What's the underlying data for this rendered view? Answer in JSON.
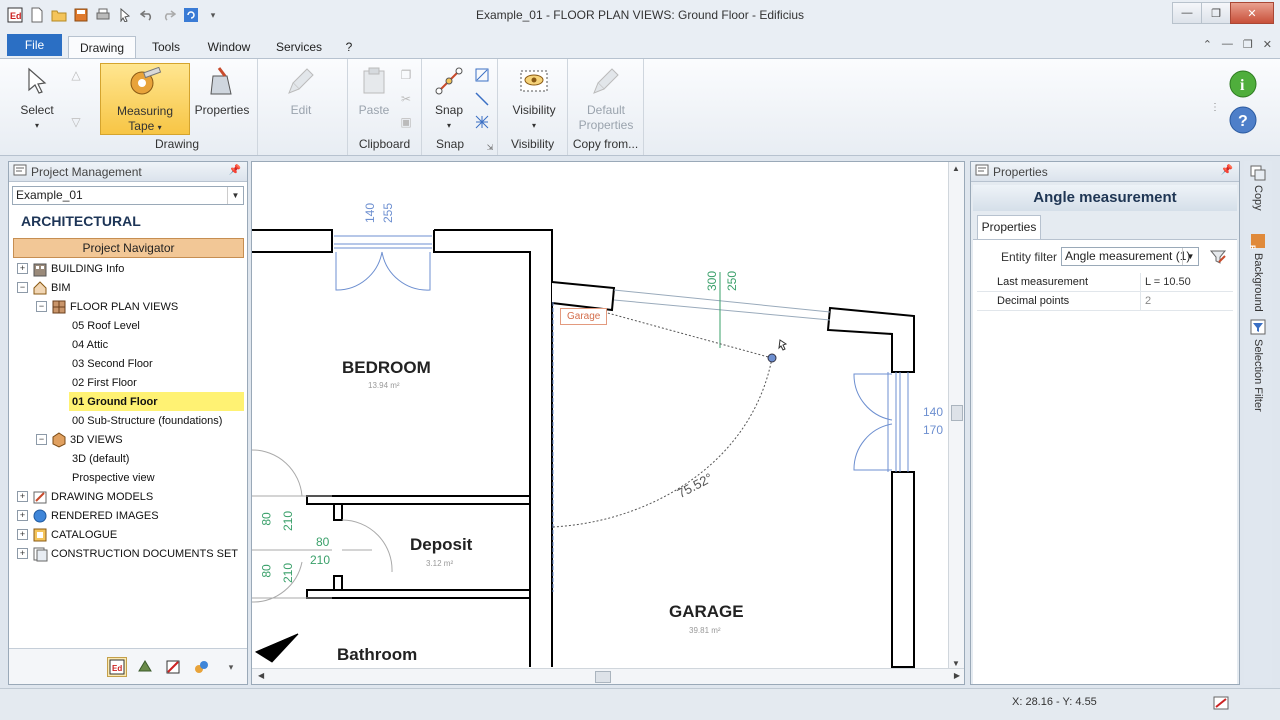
{
  "window": {
    "title": "Example_01 -  FLOOR PLAN VIEWS: Ground Floor - Edificius"
  },
  "menu": {
    "file": "File",
    "tabs": [
      "Drawing",
      "Tools",
      "Window",
      "Services",
      "?"
    ],
    "active_tab": "Drawing"
  },
  "ribbon": {
    "select": "Select",
    "measuring_tape": [
      "Measuring",
      "Tape"
    ],
    "properties": "Properties",
    "edit": "Edit",
    "drawing_group": "Drawing",
    "paste": "Paste",
    "clipboard_group": "Clipboard",
    "snap": "Snap",
    "snap_group": "Snap",
    "visibility": "Visibility",
    "visibility_group": "Visibility",
    "default_properties": [
      "Default",
      "Properties"
    ],
    "copy_from_group": "Copy from..."
  },
  "project_panel": {
    "title": "Project Management",
    "project": "Example_01",
    "section": "ARCHITECTURAL",
    "navigator": "Project Navigator",
    "tree": [
      {
        "label": "BUILDING Info",
        "expander": "+"
      },
      {
        "label": "BIM",
        "expander": "−"
      },
      {
        "label": "FLOOR PLAN VIEWS",
        "expander": "−"
      },
      {
        "label": "05 Roof Level"
      },
      {
        "label": "04 Attic"
      },
      {
        "label": "03 Second Floor"
      },
      {
        "label": "02 First Floor"
      },
      {
        "label": "01 Ground Floor",
        "selected": true
      },
      {
        "label": "00 Sub-Structure (foundations)"
      },
      {
        "label": "3D VIEWS",
        "expander": "−"
      },
      {
        "label": "3D (default)"
      },
      {
        "label": "Prospective view"
      },
      {
        "label": "DRAWING MODELS",
        "expander": "+"
      },
      {
        "label": "RENDERED IMAGES",
        "expander": "+"
      },
      {
        "label": "CATALOGUE",
        "expander": "+"
      },
      {
        "label": "CONSTRUCTION DOCUMENTS SET",
        "expander": "+"
      }
    ]
  },
  "drawing": {
    "rooms": [
      {
        "name": "BEDROOM",
        "area": "13.94 m²"
      },
      {
        "name": "Deposit",
        "area": "3.12 m²"
      },
      {
        "name": "GARAGE",
        "area": "39.81 m²"
      },
      {
        "name": "Bathroom",
        "area": ""
      }
    ],
    "tag": "Garage",
    "angle_label": "75.52°",
    "dims": {
      "top_door_1": "140",
      "top_door_2": "255",
      "garage_1": "300",
      "garage_2": "250",
      "right_1": "140",
      "right_2": "170",
      "left_1a": "80",
      "left_1b": "210",
      "left_2a": "80",
      "left_2b": "210",
      "dep_a": "80",
      "dep_b": "210"
    }
  },
  "properties_panel": {
    "title": "Properties",
    "heading": "Angle measurement",
    "tab": "Properties",
    "entity_filter_label": "Entity filter",
    "entity_filter_value": "Angle measurement (1)",
    "rows": [
      {
        "key": "Last measurement",
        "value": "L = 10.50"
      },
      {
        "key": "Decimal points",
        "value": "2"
      }
    ]
  },
  "side_tabs": [
    "Copy",
    "Background",
    "Selection Filter"
  ],
  "status": {
    "coords": "X: 28.16 - Y: 4.55"
  },
  "colors": {
    "accent": "#2b6fc4",
    "selected_tree": "#fff273",
    "navigator": "#f2c796",
    "dimension_blue": "#6d8fd0",
    "dimension_green": "#3aa06a"
  }
}
